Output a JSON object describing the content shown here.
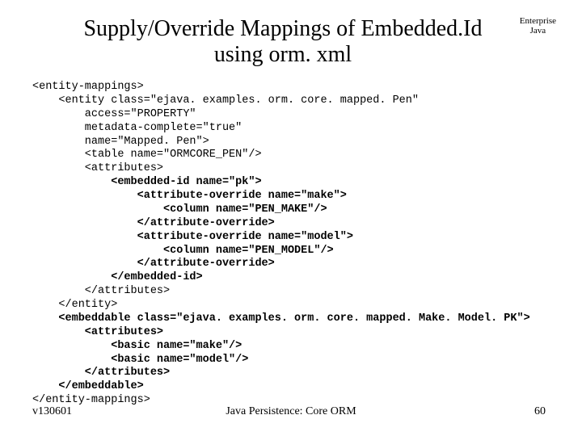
{
  "title_line1": "Supply/Override Mappings of Embedded.Id",
  "title_line2": "using orm. xml",
  "corner_line1": "Enterprise",
  "corner_line2": "Java",
  "code": {
    "l01": "<entity-mappings>",
    "l02": "    <entity class=\"ejava. examples. orm. core. mapped. Pen\"",
    "l03": "        access=\"PROPERTY\"",
    "l04": "        metadata-complete=\"true\"",
    "l05": "        name=\"Mapped. Pen\">",
    "l06": "        <table name=\"ORMCORE_PEN\"/>",
    "l07": "        <attributes>",
    "l08": "            <embedded-id name=\"pk\">",
    "l09": "                <attribute-override name=\"make\">",
    "l10": "                    <column name=\"PEN_MAKE\"/>",
    "l11": "                </attribute-override>",
    "l12": "                <attribute-override name=\"model\">",
    "l13": "                    <column name=\"PEN_MODEL\"/>",
    "l14": "                </attribute-override>",
    "l15": "            </embedded-id>",
    "l16": "        </attributes>",
    "l17": "    </entity>",
    "l18": "    <embeddable class=\"ejava. examples. orm. core. mapped. Make. Model. PK\">",
    "l19": "        <attributes>",
    "l20": "            <basic name=\"make\"/>",
    "l21": "            <basic name=\"model\"/>",
    "l22": "        </attributes>",
    "l23": "    </embeddable>",
    "l24": "</entity-mappings>"
  },
  "footer_left": "v130601",
  "footer_center": "Java Persistence: Core ORM",
  "footer_right": "60"
}
